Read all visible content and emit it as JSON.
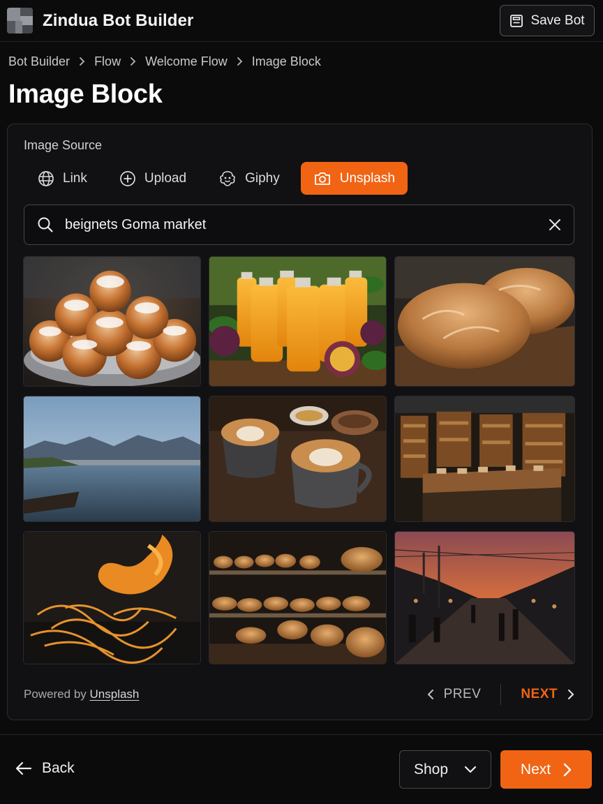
{
  "app": {
    "title": "Zindua Bot Builder",
    "save_label": "Save Bot"
  },
  "breadcrumb": [
    "Bot Builder",
    "Flow",
    "Welcome Flow",
    "Image Block"
  ],
  "page": {
    "title": "Image Block"
  },
  "image_source": {
    "label": "Image Source",
    "tabs": [
      {
        "label": "Link",
        "icon": "globe-icon"
      },
      {
        "label": "Upload",
        "icon": "upload-icon"
      },
      {
        "label": "Giphy",
        "icon": "giphy-icon"
      },
      {
        "label": "Unsplash",
        "icon": "camera-icon",
        "active": true
      }
    ]
  },
  "search": {
    "value": "beignets Goma market"
  },
  "results": [
    {
      "subject": "bowl of sugar-dusted beignets"
    },
    {
      "subject": "bottles of passion fruit juice"
    },
    {
      "subject": "crusty bread loaves on board"
    },
    {
      "subject": "lake shore with mountains"
    },
    {
      "subject": "two latte art coffees"
    },
    {
      "subject": "market hall with wooden stalls"
    },
    {
      "subject": "curled orange peel and zest"
    },
    {
      "subject": "bakery display case of pastries"
    },
    {
      "subject": "market street at sunset"
    }
  ],
  "footer": {
    "powered_prefix": "Powered by",
    "powered_link": "Unsplash",
    "prev_label": "PREV",
    "next_label": "NEXT"
  },
  "bottom": {
    "back_label": "Back",
    "select_value": "Shop",
    "next_label": "Next"
  },
  "colors": {
    "accent": "#f06414",
    "background": "#0b0b0c",
    "panel": "#111113"
  }
}
